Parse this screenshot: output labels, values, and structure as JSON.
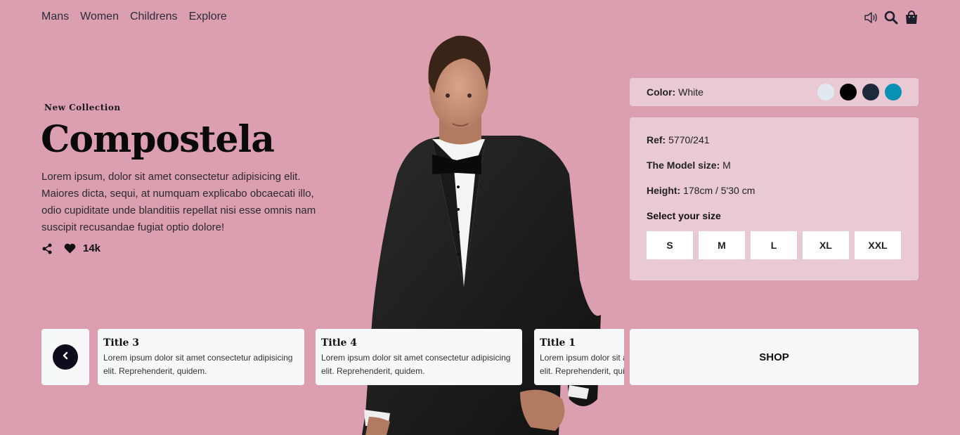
{
  "nav": {
    "items": [
      {
        "label": "Mans"
      },
      {
        "label": "Women"
      },
      {
        "label": "Childrens"
      },
      {
        "label": "Explore"
      }
    ]
  },
  "icons": {
    "sound": "volume-icon",
    "search": "search-icon",
    "bag": "shopping-bag-icon",
    "share": "share-icon",
    "like": "heart-icon",
    "prev": "chevron-left-icon"
  },
  "hero": {
    "eyebrow": "New Collection",
    "title": "Compostela",
    "description": "Lorem ipsum, dolor sit amet consectetur adipisicing elit. Maiores dicta, sequi, at numquam explicabo obcaecati illo, odio cupiditate unde blanditiis repellat nisi esse omnis nam suscipit recusandae fugiat optio dolore!",
    "likes": "14k"
  },
  "color": {
    "label": "Color:",
    "value": "White",
    "swatches": [
      "#e2e8f0",
      "#000000",
      "#1e293b",
      "#0891b2"
    ]
  },
  "details": {
    "ref_label": "Ref:",
    "ref_value": "5770/241",
    "model_label": "The Model size:",
    "model_value": "M",
    "height_label": "Height:",
    "height_value": "178cm / 5'30 cm",
    "size_heading": "Select your size",
    "sizes": [
      "S",
      "M",
      "L",
      "XL",
      "XXL"
    ]
  },
  "slides": [
    {
      "title": "Title 3",
      "text": "Lorem ipsum dolor sit amet consectetur adipisicing elit. Reprehenderit, quidem."
    },
    {
      "title": "Title 4",
      "text": "Lorem ipsum dolor sit amet consectetur adipisicing elit. Reprehenderit, quidem."
    },
    {
      "title": "Title 1",
      "text": "Lorem ipsum dolor sit amet consectetur adipisicing elit. Reprehenderit, quidem."
    }
  ],
  "shop_label": "SHOP",
  "colors": {
    "background": "#dc9fb0",
    "panel": "#e9c9d3",
    "card": "#f7f8fa",
    "dark": "#0c0c1c"
  }
}
